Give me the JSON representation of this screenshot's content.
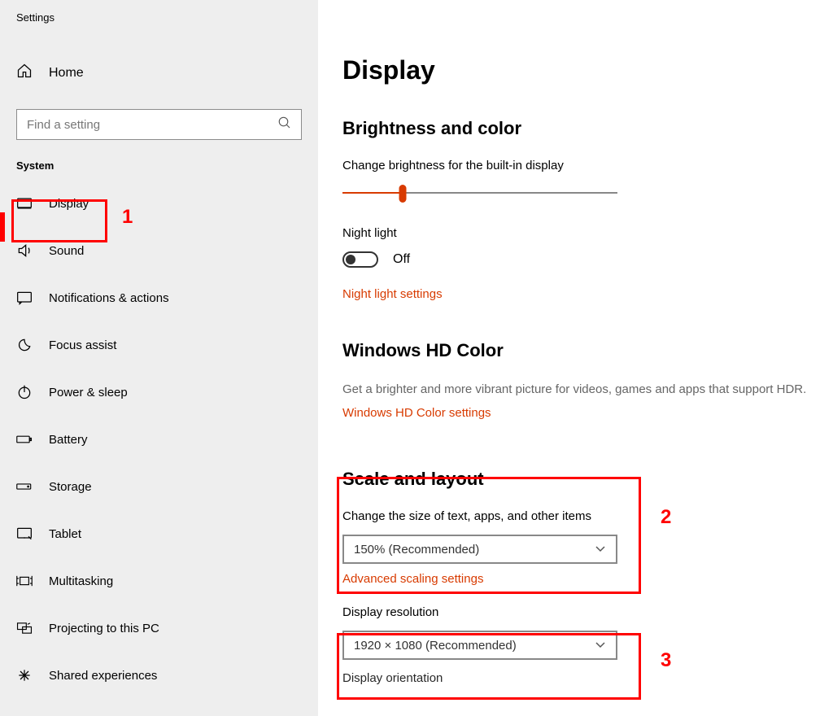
{
  "app_title": "Settings",
  "home_label": "Home",
  "search": {
    "placeholder": "Find a setting"
  },
  "category": "System",
  "nav": [
    {
      "label": "Display"
    },
    {
      "label": "Sound"
    },
    {
      "label": "Notifications & actions"
    },
    {
      "label": "Focus assist"
    },
    {
      "label": "Power & sleep"
    },
    {
      "label": "Battery"
    },
    {
      "label": "Storage"
    },
    {
      "label": "Tablet"
    },
    {
      "label": "Multitasking"
    },
    {
      "label": "Projecting to this PC"
    },
    {
      "label": "Shared experiences"
    }
  ],
  "page": {
    "title": "Display",
    "brightness": {
      "heading": "Brightness and color",
      "slider_label": "Change brightness for the built-in display",
      "night_light_label": "Night light",
      "night_light_state": "Off",
      "night_light_link": "Night light settings"
    },
    "hd": {
      "heading": "Windows HD Color",
      "desc": "Get a brighter and more vibrant picture for videos, games and apps that support HDR.",
      "link": "Windows HD Color settings"
    },
    "scale": {
      "heading": "Scale and layout",
      "scale_label": "Change the size of text, apps, and other items",
      "scale_value": "150% (Recommended)",
      "scale_link": "Advanced scaling settings",
      "resolution_label": "Display resolution",
      "resolution_value": "1920 × 1080 (Recommended)",
      "orientation_label": "Display orientation"
    }
  },
  "annotations": {
    "a1": "1",
    "a2": "2",
    "a3": "3"
  }
}
